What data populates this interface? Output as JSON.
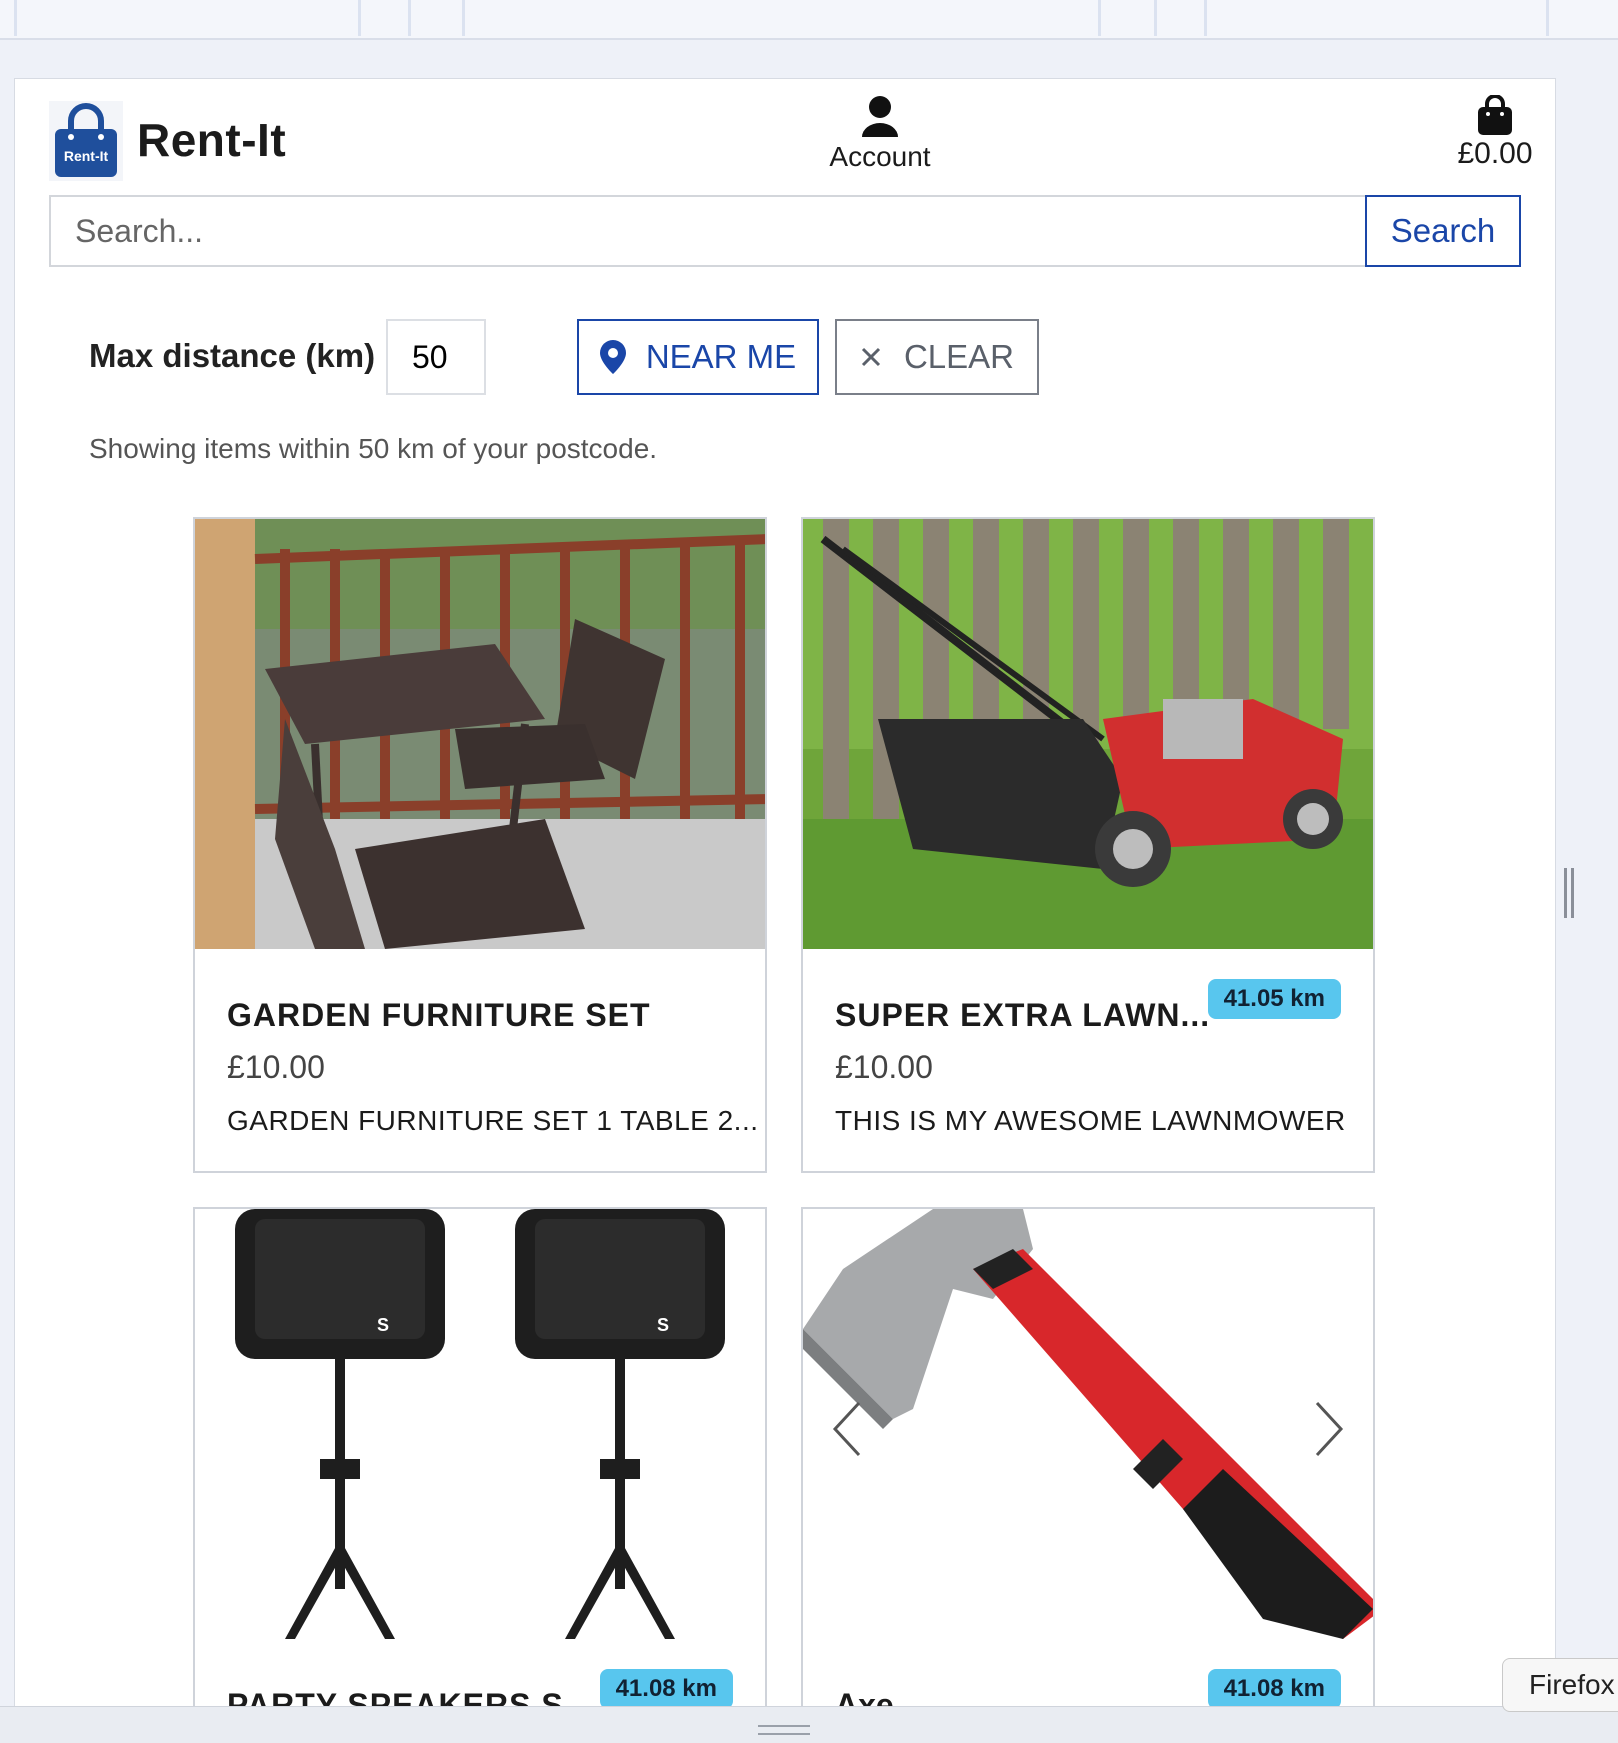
{
  "header": {
    "brand": "Rent-It",
    "logo_text": "Rent-It",
    "account_label": "Account",
    "cart_total": "£0.00"
  },
  "search": {
    "placeholder": "Search...",
    "button_label": "Search"
  },
  "filters": {
    "max_distance_label": "Max distance (km)",
    "max_distance_value": "50",
    "near_me_label": "NEAR ME",
    "clear_label": "CLEAR"
  },
  "status_text": "Showing items within 50 km of your postcode.",
  "listings": [
    {
      "title": "GARDEN FURNITURE SET",
      "price": "£10.00",
      "description": "GARDEN FURNITURE SET 1 TABLE 2...",
      "distance": ""
    },
    {
      "title": "SUPER EXTRA LAWN...",
      "price": "£10.00",
      "description": "THIS IS MY AWESOME LAWNMOWER",
      "distance": "41.05 km"
    },
    {
      "title": "PARTY SPEAKERS S...",
      "price": "",
      "description": "",
      "distance": "41.08 km"
    },
    {
      "title": "Axe",
      "price": "",
      "description": "",
      "distance": "41.08 km"
    }
  ],
  "overlay": {
    "tooltip": "Firefox"
  },
  "colors": {
    "accent": "#1a46a8",
    "badge": "#58c6ee"
  }
}
